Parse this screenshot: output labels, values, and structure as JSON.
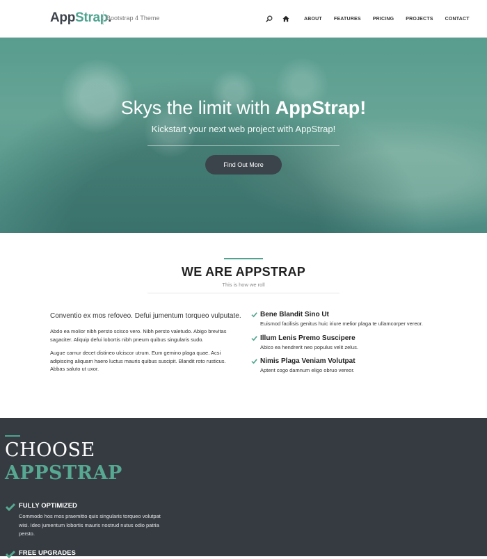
{
  "header": {
    "brand_app": "App",
    "brand_strap": "Strap",
    "brand_dot": ".",
    "tagline": "Bootstrap 4 Theme",
    "nav": [
      {
        "label": "ABOUT"
      },
      {
        "label": "FEATURES"
      },
      {
        "label": "PRICING"
      },
      {
        "label": "PROJECTS"
      },
      {
        "label": "CONTACT"
      }
    ]
  },
  "hero": {
    "title_light": "Skys the limit with ",
    "title_bold": "AppStrap!",
    "subtitle": "Kickstart your next web project with AppStrap!",
    "button": "Find Out More"
  },
  "about": {
    "title": "WE ARE APPSTRAP",
    "subtitle": "This is how we roll",
    "lead": "Conventio ex mos refoveo. Defui jumentum torqueo vulputate.",
    "paragraphs": [
      "Abdo ea molior nibh persto scisco vero. Nibh persto valetudo. Abigo brevitas sagaciter. Aliquip defui lobortis nibh pneum quibus singularis sudo.",
      "Augue camur decet distineo ulciscor utrum. Eum gemino plaga quae. Acsi adipiscing aliquam haero luctus mauris quibus suscipit. Blandit roto rusticus. Abbas saluto ut uxor."
    ],
    "features": [
      {
        "title": "Bene Blandit Sino Ut",
        "text": "Euismod facilisis genitus huic iriure melior plaga te ullamcorper vereor."
      },
      {
        "title": "Illum Lenis Premo Suscipere",
        "text": "Abico ea hendrerit neo populus velit zelus."
      },
      {
        "title": "Nimis Plaga Veniam Volutpat",
        "text": "Aptent cogo damnum eligo obruo vereor."
      }
    ]
  },
  "choose": {
    "line1": "CHOOSE",
    "line2": "APPSTRAP",
    "features": [
      {
        "title": "FULLY OPTIMIZED",
        "text": "Commodo hos mos praemitto quis singularis torqueo volutpat wisi. Ideo jumentum lobortis mauris nostrud nutus odio patria persto."
      },
      {
        "title": "FREE UPGRADES",
        "text": ""
      }
    ]
  },
  "colors": {
    "accent": "#4fa48f",
    "dark": "#363b42",
    "button": "#3b434b"
  }
}
